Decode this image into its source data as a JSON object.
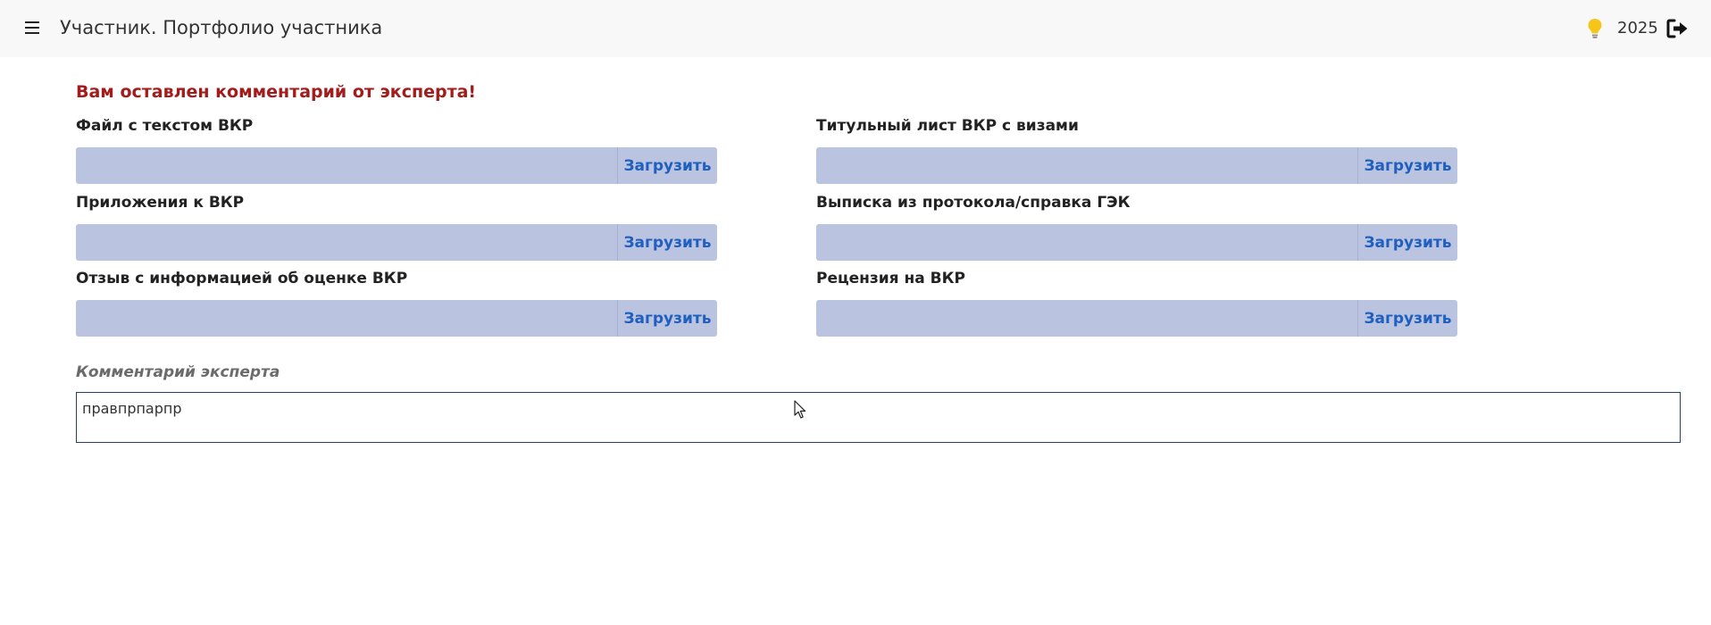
{
  "header": {
    "title": "Участник. Портфолио участника",
    "year": "2025"
  },
  "notice": "Вам оставлен комментарий от эксперта!",
  "fields": [
    {
      "label": "Файл с текстом ВКР",
      "button": "Загрузить"
    },
    {
      "label": "Титульный лист ВКР с визами",
      "button": "Загрузить"
    },
    {
      "label": "Приложения к ВКР",
      "button": "Загрузить"
    },
    {
      "label": "Выписка из протокола/справка ГЭК",
      "button": "Загрузить"
    },
    {
      "label": "Отзыв с информацией об оценке ВКР",
      "button": "Загрузить"
    },
    {
      "label": "Рецензия на ВКР",
      "button": "Загрузить"
    }
  ],
  "comment": {
    "label": "Комментарий эксперта",
    "value": "правпрпарпр"
  },
  "colors": {
    "notice": "#a31b1b",
    "upload_bg": "#bac3e0",
    "upload_button_text": "#1f5fbf",
    "bulb": "#f5c518"
  },
  "icons": [
    "menu-icon",
    "lightbulb-icon",
    "logout-icon"
  ]
}
